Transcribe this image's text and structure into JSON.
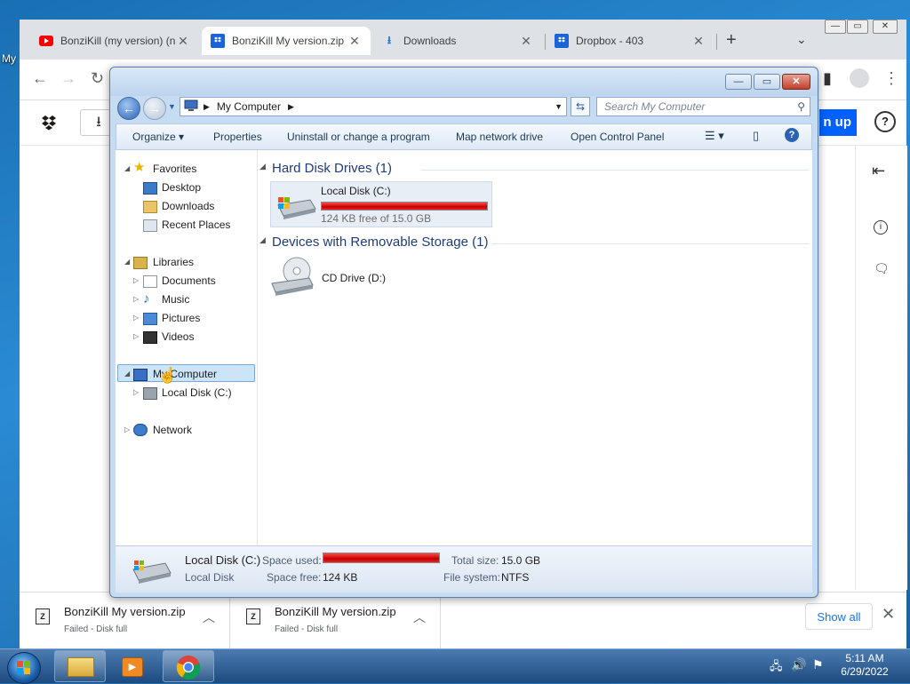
{
  "desktop": {
    "icon_label": "My"
  },
  "browser": {
    "tabs": [
      {
        "title": "BonziKill (my version) (n",
        "icon": "youtube-icon",
        "active": false
      },
      {
        "title": "BonziKill My version.zip",
        "icon": "dropbox-icon",
        "active": true
      },
      {
        "title": "Downloads",
        "icon": "download-icon",
        "active": false
      },
      {
        "title": "Dropbox - 403",
        "icon": "dropbox-icon",
        "active": false
      }
    ],
    "new_tab": "+",
    "page_button_partial": "n up",
    "downloads": [
      {
        "name": "BonziKill My version.zip",
        "status": "Failed - Disk full"
      },
      {
        "name": "BonziKill My version.zip",
        "status": "Failed - Disk full"
      }
    ],
    "show_all": "Show all"
  },
  "explorer": {
    "breadcrumb": "My Computer",
    "search_placeholder": "Search My Computer",
    "commands": [
      "Organize",
      "Properties",
      "Uninstall or change a program",
      "Map network drive",
      "Open Control Panel"
    ],
    "nav": {
      "favorites": "Favorites",
      "desktop": "Desktop",
      "downloads": "Downloads",
      "recent": "Recent Places",
      "libraries": "Libraries",
      "documents": "Documents",
      "music": "Music",
      "pictures": "Pictures",
      "videos": "Videos",
      "computer": "My Computer",
      "local_disk": "Local Disk (C:)",
      "network": "Network"
    },
    "groups": {
      "hdd": "Hard Disk Drives (1)",
      "removable": "Devices with Removable Storage (1)"
    },
    "drives": {
      "c_name": "Local Disk (C:)",
      "c_free": "124 KB free of 15.0 GB",
      "c_used_fraction": 1.0,
      "d_name": "CD Drive (D:)"
    },
    "details": {
      "name": "Local Disk (C:)",
      "type": "Local Disk",
      "space_used_label": "Space used:",
      "space_free_label": "Space free:",
      "space_free": "124 KB",
      "total_label": "Total size:",
      "total": "15.0 GB",
      "fs_label": "File system:",
      "fs": "NTFS"
    }
  },
  "taskbar": {
    "time": "5:11 AM",
    "date": "6/29/2022"
  },
  "colors": {
    "usage_bar": "#d40000",
    "accent_blue": "#0061fe"
  }
}
